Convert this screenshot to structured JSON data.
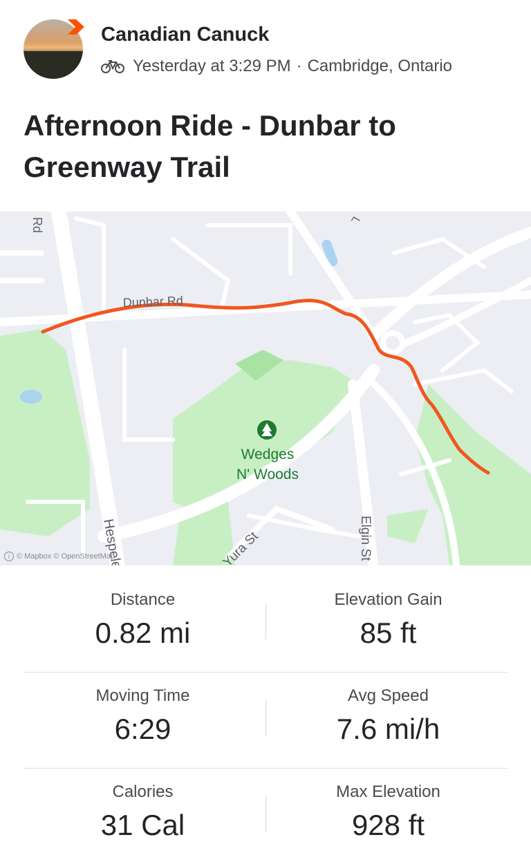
{
  "athlete": {
    "name": "Canadian Canuck",
    "time": "Yesterday at 3:29 PM",
    "separator": "·",
    "location": "Cambridge, Ontario",
    "activity_icon": "bicycle-icon"
  },
  "activity": {
    "title": "Afternoon Ride - Dunbar to Greenway Trail"
  },
  "map": {
    "labels": {
      "dunbar": "Dunbar Rd",
      "rd_top": "Rd",
      "park_line1": "Wedges",
      "park_line2": "N' Woods",
      "hespeler": "Hespeler",
      "yura": "Yura St",
      "elgin": "Elgin St",
      "l_top": "L"
    },
    "attribution": "© Mapbox © OpenStreetMap",
    "colors": {
      "route": "#f0571f",
      "park": "#c8efc4",
      "park_dark": "#a9e3a4",
      "park_label": "#1f7a31",
      "water": "#aad3f0",
      "road": "#ffffff",
      "background": "#eceef3"
    }
  },
  "stats": [
    {
      "label": "Distance",
      "value": "0.82 mi"
    },
    {
      "label": "Elevation Gain",
      "value": "85 ft"
    },
    {
      "label": "Moving Time",
      "value": "6:29"
    },
    {
      "label": "Avg Speed",
      "value": "7.6 mi/h"
    },
    {
      "label": "Calories",
      "value": "31 Cal"
    },
    {
      "label": "Max Elevation",
      "value": "928 ft"
    }
  ],
  "accent_color": "#fc5200"
}
